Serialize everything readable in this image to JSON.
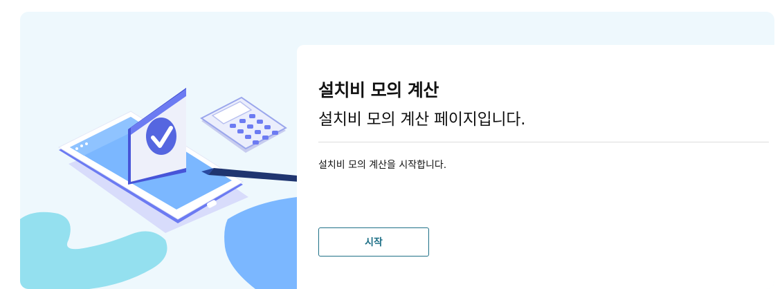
{
  "page": {
    "title": "설치비 모의 계산",
    "subtitle": "설치비 모의 계산 페이지입니다.",
    "description": "설치비 모의 계산을 시작합니다.",
    "start_button_label": "시작"
  },
  "colors": {
    "panel_bg": "#eef8fd",
    "accent": "#1d6f86",
    "illustration_blue": "#7bb7ff",
    "illustration_purple": "#6c7bf2",
    "illustration_cyan": "#94e0ef"
  },
  "icons": [
    "tablet-illustration",
    "checkmark-icon",
    "calculator-icon",
    "pen-icon"
  ]
}
